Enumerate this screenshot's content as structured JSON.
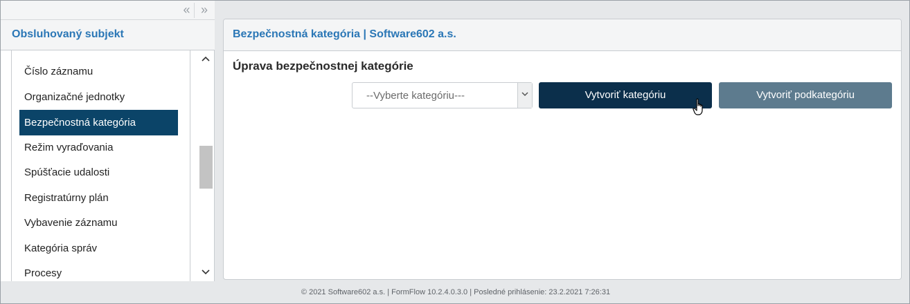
{
  "sidebar": {
    "collapse_left": "«",
    "collapse_right": "»",
    "title": "Obsluhovaný subjekt",
    "items": [
      {
        "label": "Číslo záznamu"
      },
      {
        "label": "Organizačné jednotky"
      },
      {
        "label": "Bezpečnostná kategória",
        "active": true
      },
      {
        "label": "Režim vyraďovania"
      },
      {
        "label": "Spúšťacie udalosti"
      },
      {
        "label": "Registratúrny plán"
      },
      {
        "label": "Vybavenie záznamu"
      },
      {
        "label": "Kategória správ"
      },
      {
        "label": "Procesy"
      }
    ],
    "scroll_up": "▲",
    "scroll_down": "▼"
  },
  "main": {
    "title": "Bezpečnostná kategória | Software602 a.s.",
    "section_heading": "Úprava bezpečnostnej kategórie",
    "category_select": {
      "selected": "--Vyberte kategóriu---"
    },
    "create_category_button": "Vytvoriť kategóriu",
    "create_subcategory_button": "Vytvoriť podkategóriu"
  },
  "footer": {
    "text": "© 2021 Software602 a.s. | FormFlow 10.2.4.0.3.0 | Posledné prihlásenie: 23.2.2021 7:26:31"
  },
  "icons": {
    "select_arrow": "chevron-down-icon",
    "cursor": "hand-pointer-icon"
  }
}
